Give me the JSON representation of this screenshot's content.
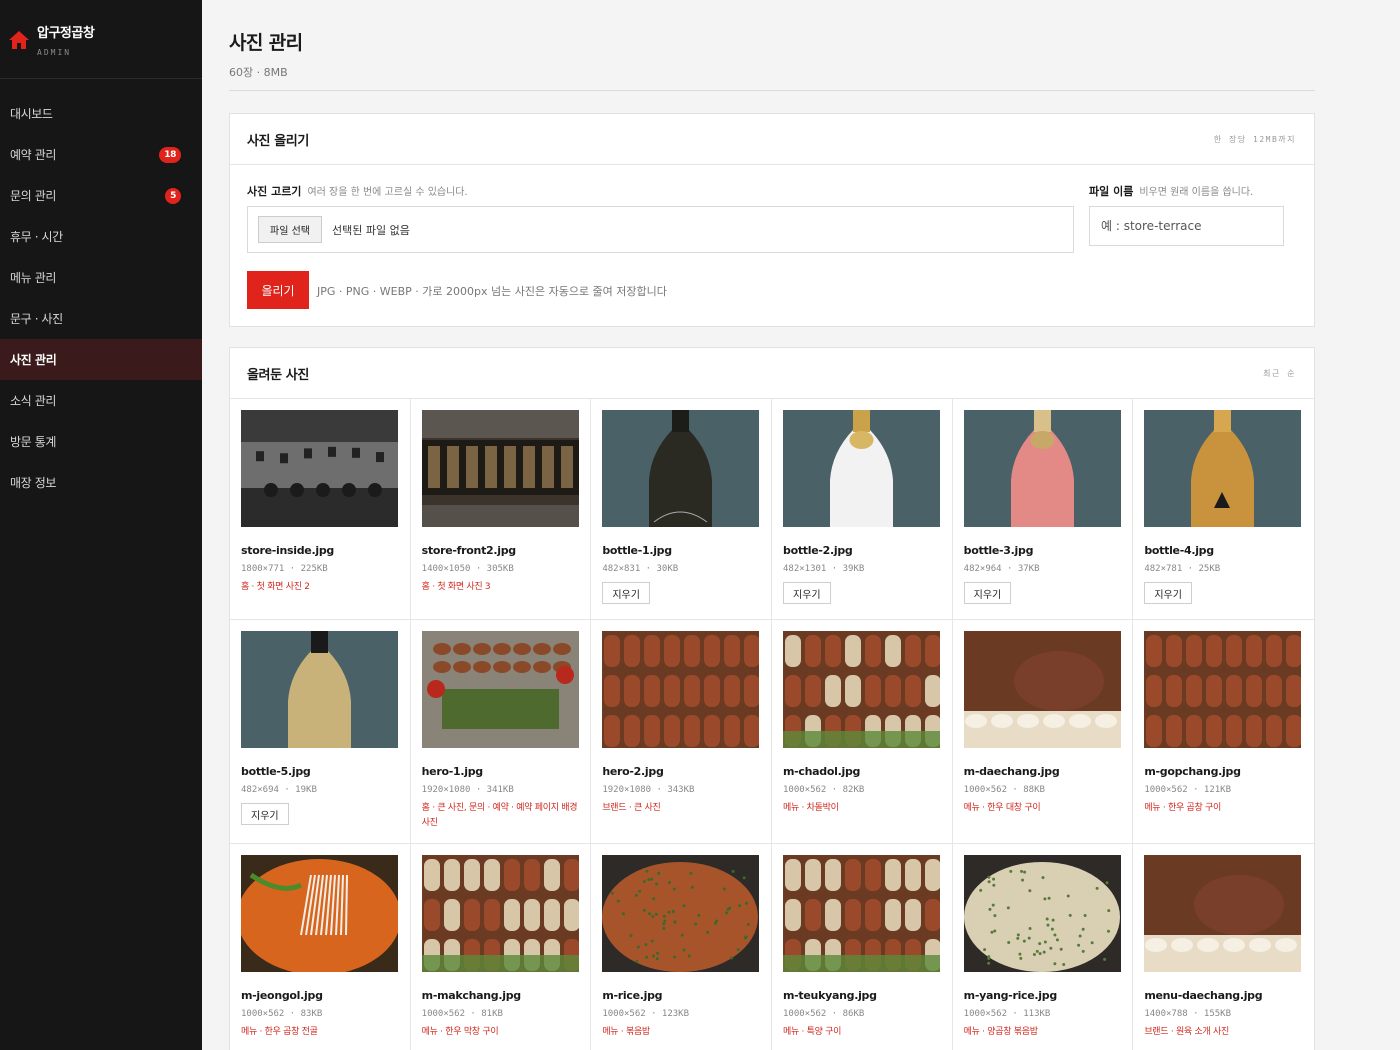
{
  "brand": {
    "name": "압구정곱창",
    "sub": "ADMIN"
  },
  "sidebar": {
    "items": [
      {
        "label": "대시보드",
        "badge": null
      },
      {
        "label": "예약 관리",
        "badge": "18"
      },
      {
        "label": "문의 관리",
        "badge": "5"
      },
      {
        "label": "휴무 · 시간",
        "badge": null
      },
      {
        "label": "메뉴 관리",
        "badge": null
      },
      {
        "label": "문구 · 사진",
        "badge": null
      },
      {
        "label": "사진 관리",
        "badge": null,
        "active": true
      },
      {
        "label": "소식 관리",
        "badge": null
      },
      {
        "label": "방문 통계",
        "badge": null
      },
      {
        "label": "매장 정보",
        "badge": null
      }
    ]
  },
  "page": {
    "title": "사진 관리",
    "subtitle": "60장 · 8MB"
  },
  "upload": {
    "title": "사진 올리기",
    "hint": "한 장당 12MB까지",
    "pick_label": "사진 고르기",
    "pick_help": "여러 장을 한 번에 고르실 수 있습니다.",
    "file_button": "파일 선택",
    "file_none": "선택된 파일 없음",
    "name_label": "파일 이름",
    "name_help": "비우면 원래 이름을 씁니다.",
    "name_placeholder": "예 : store-terrace",
    "upload_button": "올리기",
    "note": "JPG · PNG · WEBP · 가로 2000px 넘는 사진은 자동으로 줄여 저장합니다"
  },
  "list": {
    "title": "올려둔 사진",
    "sort": "최근 순",
    "delete_label": "지우기",
    "photos": [
      {
        "name": "store-inside.jpg",
        "meta": "1800×771 · 225KB",
        "use": "홈 · 첫 화면 사진 2",
        "kind": "interior"
      },
      {
        "name": "store-front2.jpg",
        "meta": "1400×1050 · 305KB",
        "use": "홈 · 첫 화면 사진 3",
        "kind": "storefront"
      },
      {
        "name": "bottle-1.jpg",
        "meta": "482×831 · 30KB",
        "use": "",
        "kind": "bottle-dark"
      },
      {
        "name": "bottle-2.jpg",
        "meta": "482×1301 · 39KB",
        "use": "",
        "kind": "bottle-white"
      },
      {
        "name": "bottle-3.jpg",
        "meta": "482×964 · 37KB",
        "use": "",
        "kind": "bottle-rose"
      },
      {
        "name": "bottle-4.jpg",
        "meta": "482×781 · 25KB",
        "use": "",
        "kind": "bottle-gold"
      },
      {
        "name": "bottle-5.jpg",
        "meta": "482×694 · 19KB",
        "use": "",
        "kind": "bottle-champ"
      },
      {
        "name": "hero-1.jpg",
        "meta": "1920×1080 · 341KB",
        "use": "홈 · 큰 사진, 문의 · 예약 · 예약 페이지 배경 사진",
        "kind": "platter"
      },
      {
        "name": "hero-2.jpg",
        "meta": "1920×1080 · 343KB",
        "use": "브랜드 · 큰 사진",
        "kind": "grill-rows"
      },
      {
        "name": "m-chadol.jpg",
        "meta": "1000×562 · 82KB",
        "use": "메뉴 · 차돌박이",
        "kind": "grill-mix"
      },
      {
        "name": "m-daechang.jpg",
        "meta": "1000×562 · 88KB",
        "use": "메뉴 · 한우 대창 구이",
        "kind": "grill-meat"
      },
      {
        "name": "m-gopchang.jpg",
        "meta": "1000×562 · 121KB",
        "use": "메뉴 · 한우 곱창 구이",
        "kind": "grill-rows"
      },
      {
        "name": "m-jeongol.jpg",
        "meta": "1000×562 · 83KB",
        "use": "메뉴 · 한우 곱창 전골",
        "kind": "stew"
      },
      {
        "name": "m-makchang.jpg",
        "meta": "1000×562 · 81KB",
        "use": "메뉴 · 한우 막창 구이",
        "kind": "grill-mix"
      },
      {
        "name": "m-rice.jpg",
        "meta": "1000×562 · 123KB",
        "use": "메뉴 · 볶음밥",
        "kind": "rice"
      },
      {
        "name": "m-teukyang.jpg",
        "meta": "1000×562 · 86KB",
        "use": "메뉴 · 특양 구이",
        "kind": "grill-mix"
      },
      {
        "name": "m-yang-rice.jpg",
        "meta": "1000×562 · 113KB",
        "use": "메뉴 · 양곱창 볶음밥",
        "kind": "rice-pan"
      },
      {
        "name": "menu-daechang.jpg",
        "meta": "1400×788 · 155KB",
        "use": "브랜드 · 원육 소개 사진",
        "kind": "grill-meat"
      }
    ]
  },
  "colors": {
    "accent": "#e0241c",
    "sidebar_bg": "#161616",
    "bottle_bg": "#4a6168"
  }
}
